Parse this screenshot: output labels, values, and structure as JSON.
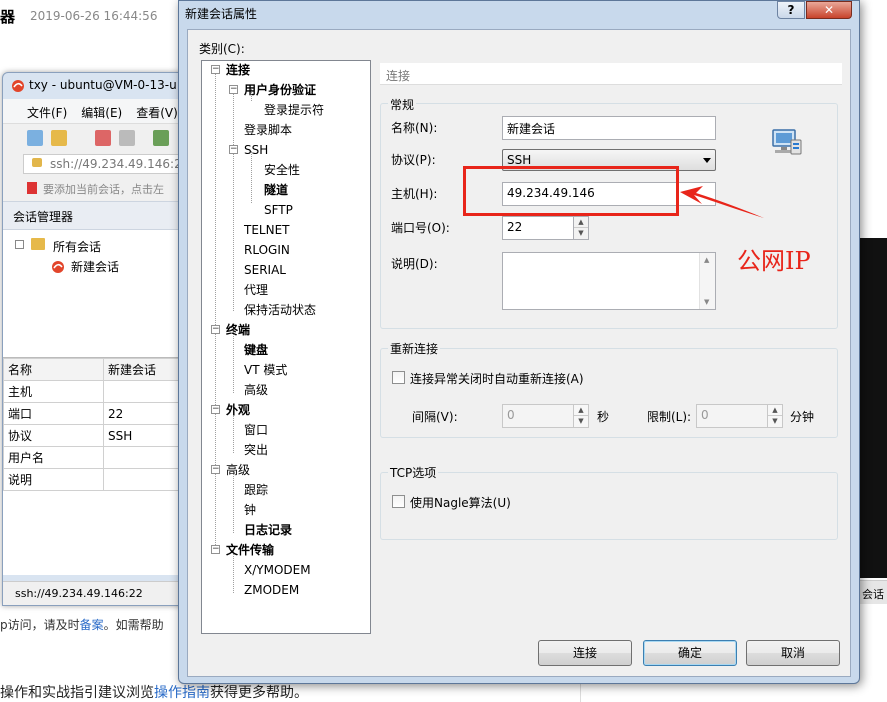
{
  "background_page": {
    "heading": "器",
    "date": "2019-06-26 16:44:56",
    "line1_prefix": "p访问，请及时",
    "line1_link": "备案",
    "line1_suffix": "。如需帮助",
    "line2_prefix": "操作和实战指引建议浏览",
    "line2_link": "操作指南",
    "line2_suffix": "获得更多帮助。",
    "right_strip_text": "会话"
  },
  "xshell": {
    "title": "txy - ubuntu@VM-0-13-u",
    "menu": [
      "文件(F)",
      "编辑(E)",
      "查看(V)"
    ],
    "address": "ssh://49.234.49.146:22",
    "hint": "要添加当前会话，点击左",
    "session_manager_title": "会话管理器",
    "tree": {
      "root": "所有会话",
      "child": "新建会话"
    },
    "props_header": [
      "名称",
      "新建会话"
    ],
    "props_rows": [
      [
        "主机",
        ""
      ],
      [
        "端口",
        "22"
      ],
      [
        "协议",
        "SSH"
      ],
      [
        "用户名",
        ""
      ],
      [
        "说明",
        ""
      ]
    ],
    "status": "ssh://49.234.49.146:22"
  },
  "dialog": {
    "title": "新建会话属性",
    "help_label": "?",
    "close_label": "✕",
    "category_label": "类别(C):",
    "tree": {
      "connect": "连接",
      "user_auth": "用户身份验证",
      "login_prompt": "登录提示符",
      "login_script": "登录脚本",
      "ssh": "SSH",
      "security": "安全性",
      "tunnel": "隧道",
      "sftp": "SFTP",
      "telnet": "TELNET",
      "rlogin": "RLOGIN",
      "serial": "SERIAL",
      "proxy": "代理",
      "keepalive": "保持活动状态",
      "terminal": "终端",
      "keyboard": "键盘",
      "vt_mode": "VT 模式",
      "advanced_term": "高级",
      "appearance": "外观",
      "window": "窗口",
      "highlight": "突出",
      "advanced": "高级",
      "trace": "跟踪",
      "bell": "钟",
      "logging": "日志记录",
      "file_transfer": "文件传输",
      "xymodem": "X/YMODEM",
      "zmodem": "ZMODEM"
    },
    "section_title": "连接",
    "general": {
      "legend": "常规",
      "name_label": "名称(N):",
      "name_value": "新建会话",
      "protocol_label": "协议(P):",
      "protocol_value": "SSH",
      "host_label": "主机(H):",
      "host_value": "49.234.49.146",
      "port_label": "端口号(O):",
      "port_value": "22",
      "desc_label": "说明(D):",
      "desc_value": ""
    },
    "reconnect": {
      "legend": "重新连接",
      "checkbox_label": "连接异常关闭时自动重新连接(A)",
      "interval_label": "间隔(V):",
      "interval_value": "0",
      "interval_unit": "秒",
      "limit_label": "限制(L):",
      "limit_value": "0",
      "limit_unit": "分钟"
    },
    "tcp": {
      "legend": "TCP选项",
      "nagle_label": "使用Nagle算法(U)"
    },
    "buttons": {
      "connect": "连接",
      "ok": "确定",
      "cancel": "取消"
    }
  },
  "annotation": {
    "text": "公网IP",
    "color": "#e8251a"
  },
  "icons": [
    "xshell-logo-icon",
    "computer-network-icon",
    "folder-icon",
    "lock-icon",
    "bookmark-flag-icon"
  ]
}
